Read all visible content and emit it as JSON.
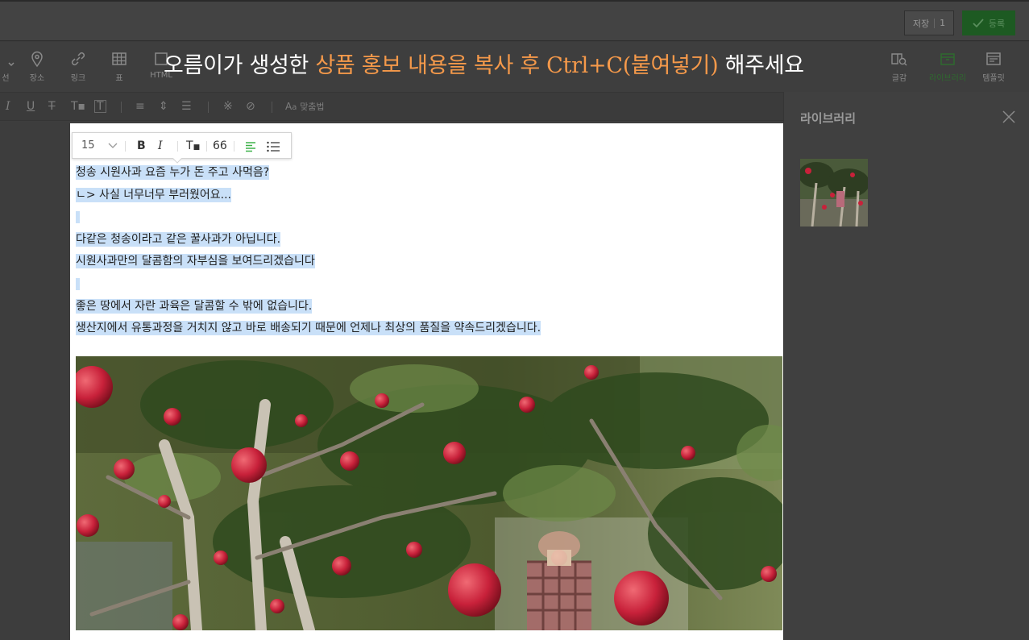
{
  "header": {
    "save_label": "저장",
    "save_count": "1",
    "publish_label": "등록"
  },
  "toolbar": {
    "items": [
      {
        "label": "선",
        "icon": "line-icon"
      },
      {
        "label": "장소",
        "icon": "map-pin-icon"
      },
      {
        "label": "링크",
        "icon": "link-icon"
      },
      {
        "label": "표",
        "icon": "table-icon"
      },
      {
        "label": "HTML",
        "icon": "html-icon"
      },
      {
        "label": "글감",
        "icon": "book-search-icon"
      },
      {
        "label": "라이브러리",
        "icon": "library-icon"
      },
      {
        "label": "템플릿",
        "icon": "template-icon"
      }
    ],
    "spell_label": "맞춤법"
  },
  "banner": {
    "part1": "오름이가 생성한 ",
    "highlight": "상품 홍보 내용을 복사 후 Ctrl+C(붙여넣기)",
    "part2": " 해주세요",
    "highlight_color": "#f5994a"
  },
  "float_toolbar": {
    "font_size": "15",
    "bold": "B",
    "italic": "I",
    "quote": "66"
  },
  "content": {
    "lines": [
      "청송 시원사과 요즘 누가 돈 주고 사먹음?",
      "ㄴ> 사실 너무너무 부러웠어요...",
      "다같은 청송이라고 같은 꿀사과가 아닙니다.",
      "시원사과만의 달콤함의 자부심을 보여드리겠습니다",
      "좋은 땅에서 자란 과육은 달콤할 수 밖에 없습니다.",
      "생산지에서 유통과정을 거치지 않고 바로 배송되기 때문에 언제나 최상의 품질을 약속드리겠습니다."
    ],
    "selection_color": "#c9e0f8"
  },
  "panel": {
    "title": "라이브러리"
  }
}
